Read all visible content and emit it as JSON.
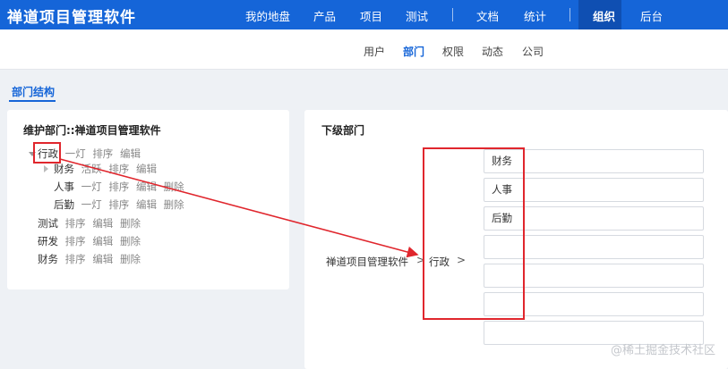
{
  "app": {
    "brand": "禅道项目管理软件"
  },
  "top_nav": {
    "items": [
      "我的地盘",
      "产品",
      "项目",
      "测试",
      "文档",
      "统计",
      "组织",
      "后台"
    ],
    "active": "组织"
  },
  "sub_nav": {
    "items": [
      "用户",
      "部门",
      "权限",
      "动态",
      "公司"
    ],
    "active": "部门"
  },
  "section_tab": "部门结构",
  "left_panel": {
    "title": "维护部门::禅道项目管理软件",
    "tree": [
      {
        "name": "行政",
        "actions": [
          "一灯",
          "排序",
          "编辑"
        ]
      },
      {
        "name": "财务",
        "actions": [
          "活跃",
          "排序",
          "编辑"
        ]
      },
      {
        "name": "人事",
        "actions": [
          "一灯",
          "排序",
          "编辑",
          "删除"
        ]
      },
      {
        "name": "后勤",
        "actions": [
          "一灯",
          "排序",
          "编辑",
          "删除"
        ]
      },
      {
        "name": "测试",
        "actions": [
          "排序",
          "编辑",
          "删除"
        ]
      },
      {
        "name": "研发",
        "actions": [
          "排序",
          "编辑",
          "删除"
        ]
      },
      {
        "name": "财务",
        "actions": [
          "排序",
          "编辑",
          "删除"
        ]
      }
    ]
  },
  "right_panel": {
    "title": "下级部门",
    "breadcrumb": [
      "禅道项目管理软件",
      "行政"
    ],
    "breadcrumb_sep": ">",
    "child_departments": [
      "财务",
      "人事",
      "后勤",
      "",
      "",
      "",
      ""
    ]
  },
  "watermark": "@稀土掘金技术社区",
  "colors": {
    "primary": "#1565d8",
    "annotation": "#e0262d"
  }
}
